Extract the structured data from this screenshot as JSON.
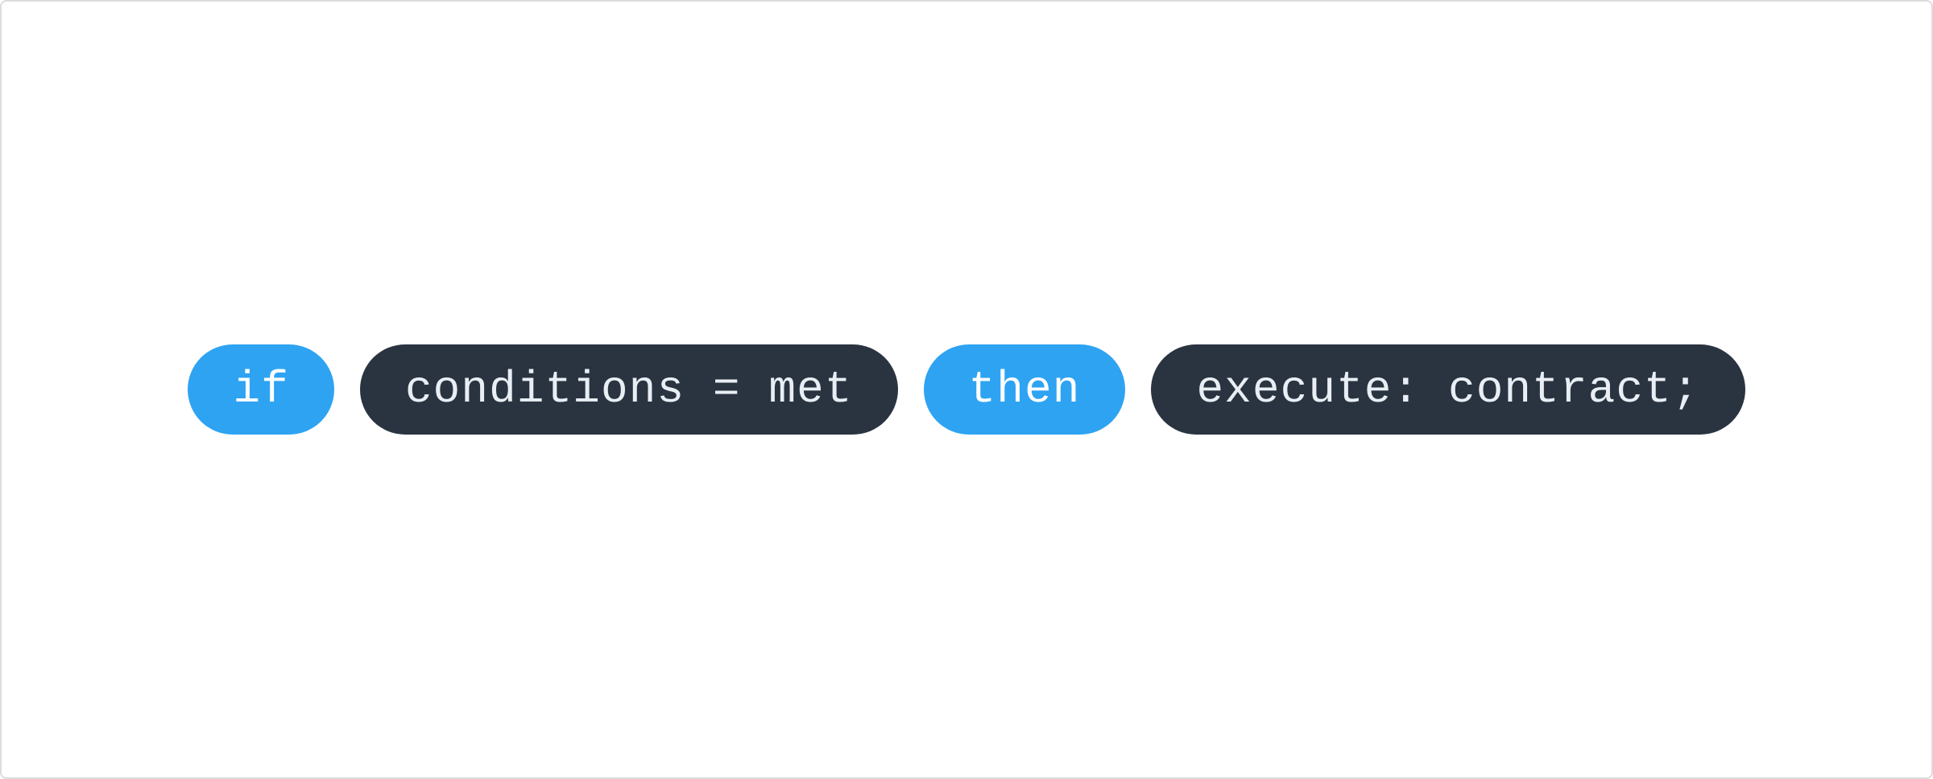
{
  "pills": {
    "keyword_if": "if",
    "statement_conditions": "conditions = met",
    "keyword_then": "then",
    "statement_execute": "execute: contract;"
  }
}
